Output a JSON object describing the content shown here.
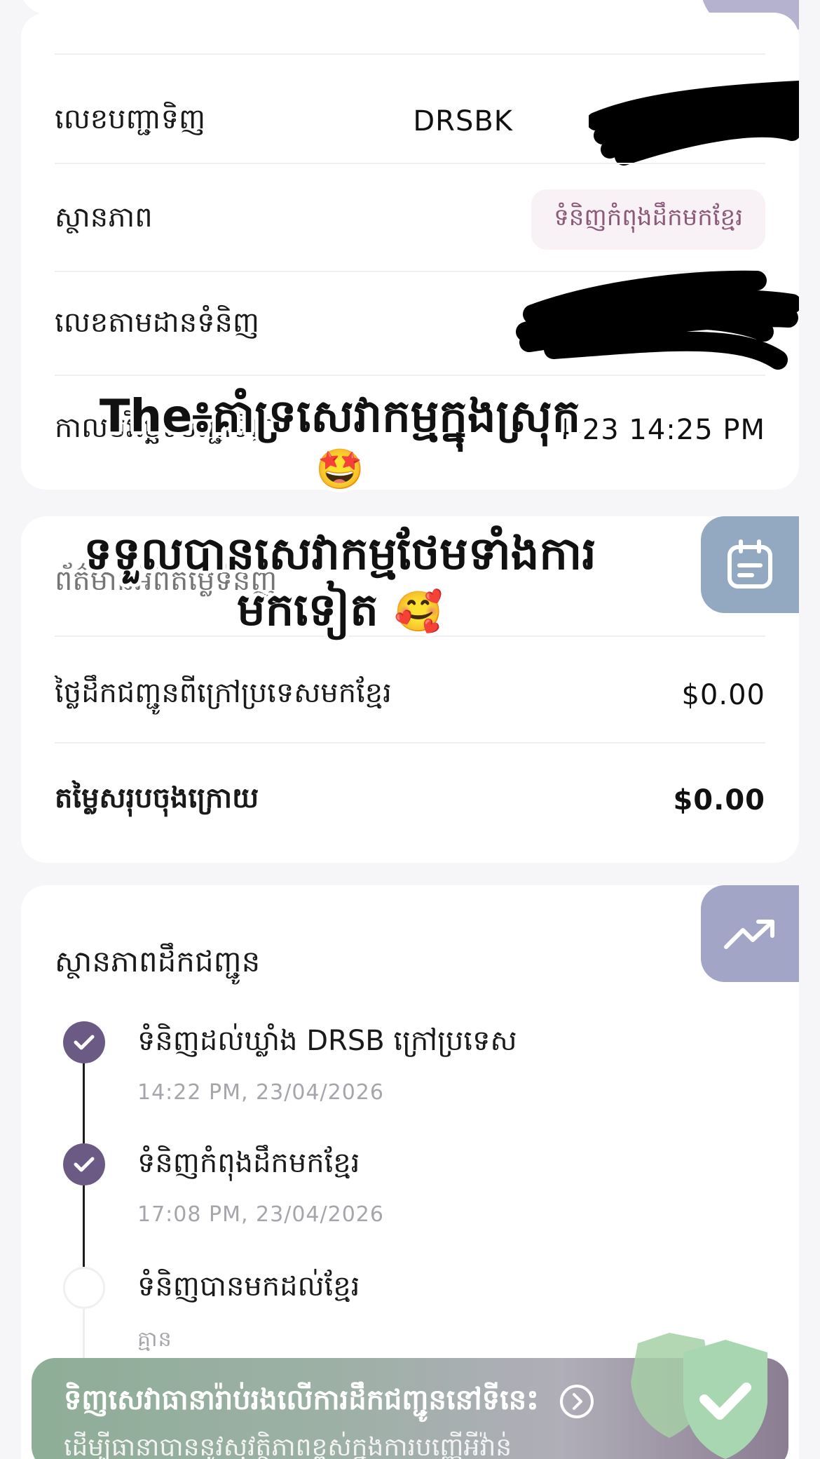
{
  "order_card": {
    "order_number_label": "លេខបញ្ជាទិញ",
    "order_number_value": "DRSBK",
    "status_label": "ស្ថានភាព",
    "status_value": "ទំនិញកំពុងដឹកមកខ្មែរ",
    "tracking_label": "លេខតាមដានទំនិញ",
    "ordered_at_label": "កាលបរិច្ឆេទបញ្ជាទិញ",
    "ordered_at_value": "4-23 14:25 PM"
  },
  "overlay": {
    "line1": "The៖គាំទ្រសេវាកម្មក្នុងស្រុក",
    "line1_emoji": "🤩",
    "line2": "ទទួលបានសេវាកម្មថែមទាំងការ",
    "line3": "មកទៀត",
    "line3_emoji": "🥰"
  },
  "fee_card": {
    "header_label": "ព័ត៌មានអំពីតម្លៃទំនិញ",
    "shipping_label": "ថ្លៃដឹកជញ្ជូនពីក្រៅប្រទេសមកខ្មែរ",
    "shipping_value": "$0.00",
    "total_label": "តម្លៃសរុបចុងក្រោយ",
    "total_value": "$0.00",
    "badge_icon": "calendar-icon",
    "badge_color": "#93a9c2"
  },
  "shipping_status": {
    "title": "ស្ថានភាពដឹកជញ្ជូន",
    "badge_icon": "trending-up-icon",
    "badge_color": "#a3a5c6",
    "steps": [
      {
        "title": "ទំនិញដល់ឃ្លាំង DRSB ក្រៅប្រទេស",
        "time": "14:22 PM, 23/04/2026",
        "done": true
      },
      {
        "title": "ទំនិញកំពុងដឹកមកខ្មែរ",
        "time": "17:08 PM, 23/04/2026",
        "done": true
      },
      {
        "title": "ទំនិញបានមកដល់ខ្មែរ",
        "time": "គ្មាន",
        "done": false
      }
    ]
  },
  "banner": {
    "title": "ទិញសេវាធានារ៉ាប់រងលើការដឹកជញ្ជូននៅទីនេះ",
    "subtitle": "ដើម្បីធានាបាននូវសុវត្ថិភាពខ្ពស់ក្នុងការបញ្ញើអីវ៉ាន់",
    "icon": "shield-check-icon"
  },
  "colors": {
    "accent": "#6b5a84",
    "status_pill_bg": "#f8f1f5",
    "status_pill_text": "#8a5a78"
  }
}
